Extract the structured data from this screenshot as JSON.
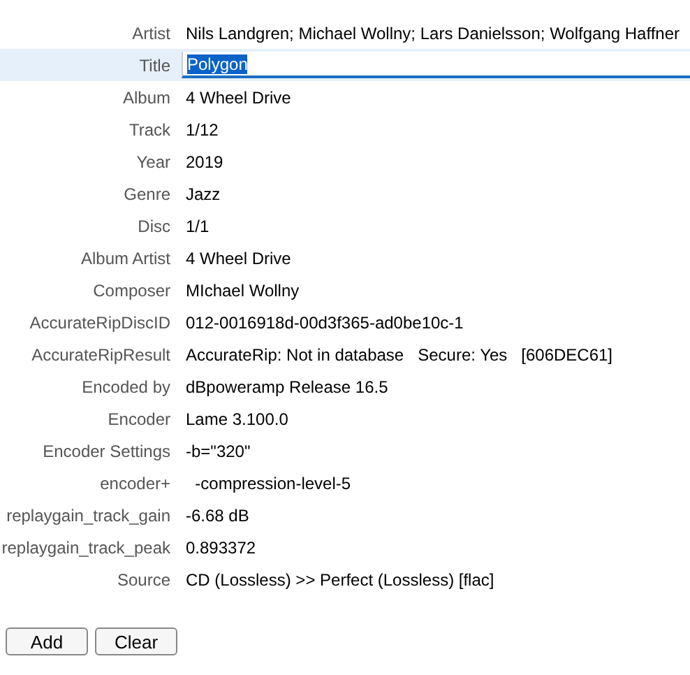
{
  "tags": [
    {
      "label": "Artist",
      "value": "Nils Landgren; Michael Wollny; Lars Danielsson; Wolfgang Haffner",
      "selected": false
    },
    {
      "label": "Title",
      "value": "Polygon",
      "selected": true
    },
    {
      "label": "Album",
      "value": "4 Wheel Drive",
      "selected": false
    },
    {
      "label": "Track",
      "value": "1/12",
      "selected": false
    },
    {
      "label": "Year",
      "value": "2019",
      "selected": false
    },
    {
      "label": "Genre",
      "value": "Jazz",
      "selected": false
    },
    {
      "label": "Disc",
      "value": "1/1",
      "selected": false
    },
    {
      "label": "Album Artist",
      "value": "4 Wheel Drive",
      "selected": false
    },
    {
      "label": "Composer",
      "value": "MIchael Wollny",
      "selected": false
    },
    {
      "label": "AccurateRipDiscID",
      "value": "012-0016918d-00d3f365-ad0be10c-1",
      "selected": false
    },
    {
      "label": "AccurateRipResult",
      "value": "AccurateRip: Not in database   Secure: Yes   [606DEC61]",
      "selected": false
    },
    {
      "label": "Encoded by",
      "value": "dBpoweramp Release 16.5",
      "selected": false
    },
    {
      "label": "Encoder",
      "value": "Lame 3.100.0",
      "selected": false
    },
    {
      "label": "Encoder Settings",
      "value": "-b=\"320\"",
      "selected": false
    },
    {
      "label": "encoder+",
      "value": "  -compression-level-5",
      "selected": false
    },
    {
      "label": "replaygain_track_gain",
      "value": "-6.68 dB",
      "selected": false
    },
    {
      "label": "replaygain_track_peak",
      "value": "0.893372",
      "selected": false
    },
    {
      "label": "Source",
      "value": "CD (Lossless) >> Perfect (Lossless) [flac]",
      "selected": false
    }
  ],
  "buttons": [
    "Add",
    "Clear"
  ]
}
